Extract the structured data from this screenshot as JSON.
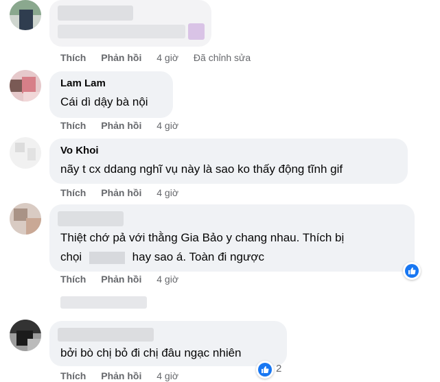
{
  "colors": {
    "link_blue": "#1877f2",
    "bubble_bg": "#f0f2f5",
    "meta_gray": "#65676b"
  },
  "comments": [
    {
      "name": "",
      "text": "",
      "actions": {
        "like": "Thích",
        "reply": "Phản hồi",
        "time": "4 giờ",
        "edited": "Đã chỉnh sửa"
      }
    },
    {
      "name": "Lam Lam",
      "text": "Cái dì dậy bà nội",
      "actions": {
        "like": "Thích",
        "reply": "Phản hồi",
        "time": "4 giờ"
      }
    },
    {
      "name": "Vo Khoi",
      "text": "nãy t cx ddang nghĩ vụ này là sao ko thấy động tĩnh gif",
      "actions": {
        "like": "Thích",
        "reply": "Phản hồi",
        "time": "4 giờ"
      }
    },
    {
      "name": "",
      "text_line1": "Thiệt chớ pả với thằng Gia Bảo y chang nhau. Thích bị",
      "text_line2_a": "chọi",
      "text_line2_b": "hay sao á. Toàn đi ngược",
      "reaction_icon": "like-icon",
      "actions": {
        "like": "Thích",
        "reply": "Phản hồi",
        "time": "4 giờ"
      }
    },
    {
      "name": "",
      "text": "bởi bò chị bỏ đi chị đâu ngạc nhiên",
      "reaction_icon": "like-icon",
      "reaction_count": "2",
      "actions": {
        "like": "Thích",
        "reply": "Phản hồi",
        "time": "4 giờ"
      }
    }
  ]
}
